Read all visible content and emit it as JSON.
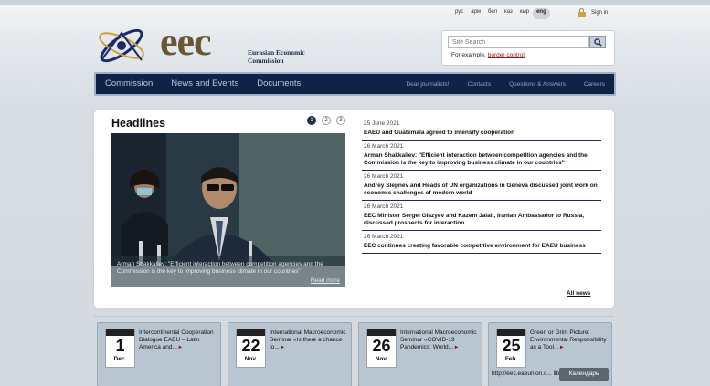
{
  "header": {
    "languages": [
      "рус",
      "арм",
      "бел",
      "каз",
      "кыр",
      "eng"
    ],
    "active_language": "eng",
    "signin_label": "Sign in",
    "logo_text": "eec",
    "logo_subtitle_line1": "Eurasian Economic",
    "logo_subtitle_line2": "Commission"
  },
  "search": {
    "placeholder": "Site Search",
    "example_prefix": "For example,",
    "example_link": "border control"
  },
  "nav": {
    "main": [
      "Commission",
      "News and Events",
      "Documents"
    ],
    "secondary": [
      "Dear journalists!",
      "Contacts",
      "Questions & Answers",
      "Careers"
    ]
  },
  "headlines": {
    "title": "Headlines",
    "pages": [
      "1",
      "2",
      "3"
    ],
    "active_page": "1",
    "photo_caption": "Arman Shakkaliev: \"Efficient interaction between competition agencies and the Commission is the key to improving business climate in our countries\"",
    "read_more": "Read more",
    "items": [
      {
        "date": "25 June 2021",
        "title": "EAEU and Guatemala agreed to intensify cooperation"
      },
      {
        "date": "26 March 2021",
        "title": "Arman Shakkaliev: \"Efficient interaction between competition agencies and the Commission is the key to improving business climate in our countries\""
      },
      {
        "date": "26 March 2021",
        "title": "Andrey Slepnev and Heads of UN organizations in Geneva discussed joint work on economic challenges of modern world"
      },
      {
        "date": "26 March 2021",
        "title": "EEC Minister Sergei Glazyev and Kazem Jalali, Iranian Ambassador to Russia, discussed prospects for interaction"
      },
      {
        "date": "26 March 2021",
        "title": "EEC continues creating favorable competitive environment for EAEU business"
      }
    ],
    "all_news": "All news"
  },
  "events": [
    {
      "day": "1",
      "month": "Dec.",
      "text": "Intercontinental Cooperation Dialogue EAEU – Latin America and..."
    },
    {
      "day": "22",
      "month": "Nov.",
      "text": "International Macroeconomic Seminar «Is there a chance to..."
    },
    {
      "day": "26",
      "month": "Nov.",
      "text": "International Macroeconomic Seminar «COVID-19 Pandemics: World..."
    },
    {
      "day": "25",
      "month": "Feb.",
      "text": "Green or Grim Picture: Environmental Responsibility as a Tool..."
    }
  ],
  "calendar_button": "Календарь",
  "status_tooltip": "http://eec.eaeunion.c... libe program.pdf",
  "colors": {
    "nav_bg": "#0f2347",
    "logo_brown": "#6b5632",
    "accent_red": "#8a1c1c"
  }
}
